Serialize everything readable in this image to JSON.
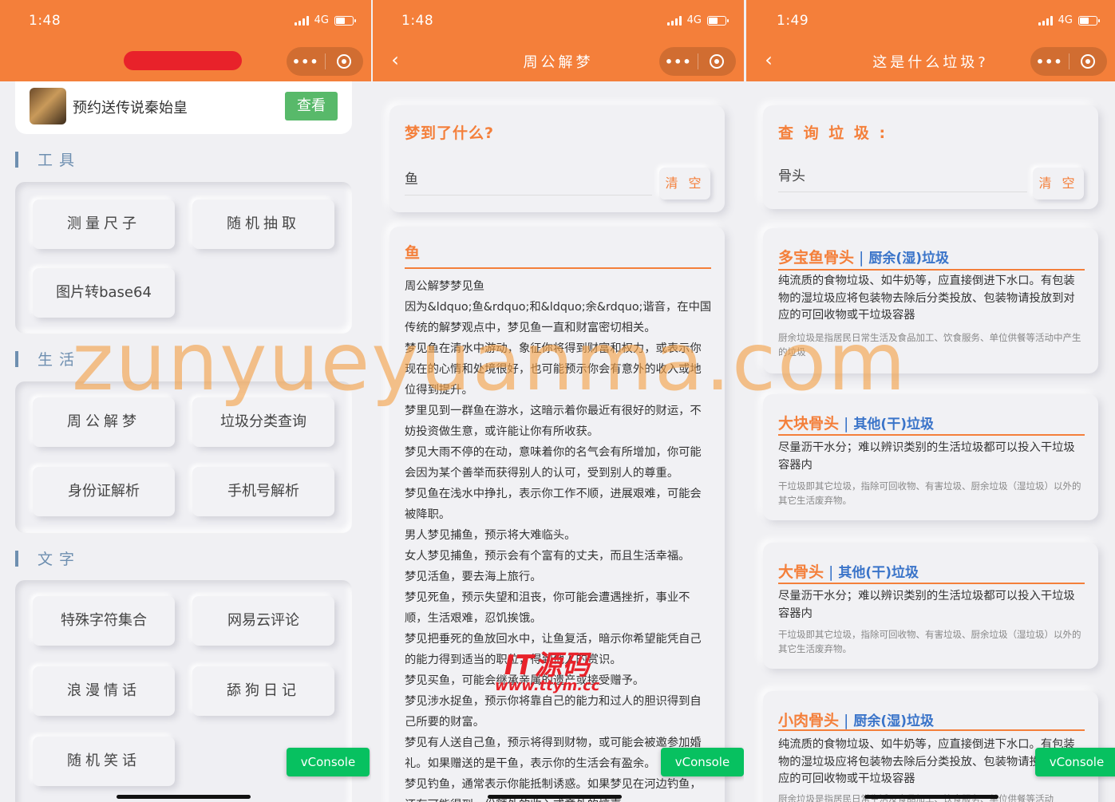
{
  "screens": [
    {
      "time": "1:48",
      "network": "4G",
      "banner": {
        "text": "预约送传说秦始皇",
        "button": "查看"
      },
      "sections": [
        {
          "title": "工具",
          "items": [
            "测量尺子",
            "随机抽取",
            "图片转base64"
          ]
        },
        {
          "title": "生活",
          "items": [
            "周公解梦",
            "垃圾分类查询",
            "身份证解析",
            "手机号解析"
          ]
        },
        {
          "title": "文字",
          "items": [
            "特殊字符集合",
            "网易云评论",
            "浪漫情话",
            "舔狗日记",
            "随机笑话"
          ]
        }
      ],
      "vconsole": "vConsole"
    },
    {
      "time": "1:48",
      "network": "4G",
      "title": "周公解梦",
      "query_label": "梦到了什么?",
      "query_value": "鱼",
      "clear": "清 空",
      "result_title": "鱼",
      "result_lines": [
        "周公解梦梦见鱼",
        "因为&ldquo;鱼&rdquo;和&ldquo;余&rdquo;谐音，在中国",
        "传统的解梦观点中，梦见鱼一直和财富密切相关。",
        "梦见鱼在清水中游动，象征你将得到财富和权力，或表示你",
        "现在的心情和处境很好，也可能预示你会有意外的收入或地",
        "位得到提升。",
        "梦里见到一群鱼在游水，这暗示着你最近有很好的财运，不",
        "妨投资做生意，或许能让你有所收获。",
        "梦见大雨不停的在动，意味着你的名气会有所增加，你可能",
        "会因为某个善举而获得别人的认可，受到别人的尊重。",
        "梦见鱼在浅水中挣扎，表示你工作不顺，进展艰难，可能会",
        "被降职。",
        "男人梦见捕鱼，预示将大难临头。",
        "女人梦见捕鱼，预示会有个富有的丈夫，而且生活幸福。",
        "梦见活鱼，要去海上旅行。",
        "梦见死鱼，预示失望和沮丧，你可能会遭遇挫折，事业不",
        "顺，生活艰难，忍饥挨饿。",
        "梦见把垂死的鱼放回水中，让鱼复活，暗示你希望能凭自己",
        "的能力得到适当的职位，得到他人的赏识。",
        "梦见买鱼，可能会继承亲属的遗产或接受赠予。",
        "梦见涉水捉鱼，预示你将靠自己的能力和过人的胆识得到自",
        "己所要的财富。",
        "梦见有人送自己鱼，预示将得到财物，或可能会被邀参加婚",
        "礼。如果赠送的是干鱼，表示你的生活会有盈余。",
        "梦见钓鱼，通常表示你能抵制诱惑。如果梦见在河边钓鱼，",
        "还有可能得到一份额外的收入或意外的惊喜。"
      ],
      "vconsole": "vConsole"
    },
    {
      "time": "1:49",
      "network": "4G",
      "title": "这是什么垃圾?",
      "query_label": "查 询 垃 圾 :",
      "query_value": "骨头",
      "clear": "清 空",
      "results": [
        {
          "name": "多宝鱼骨头",
          "category": "厨余(湿)垃圾",
          "desc": "纯流质的食物垃圾、如牛奶等，应直接倒进下水口。有包装物的湿垃圾应将包装物去除后分类投放、包装物请投放到对应的可回收物或干垃圾容器",
          "note": "厨余垃圾是指居民日常生活及食品加工、饮食服务、单位供餐等活动中产生的垃圾"
        },
        {
          "name": "大块骨头",
          "category": "其他(干)垃圾",
          "desc": "尽量沥干水分；难以辨识类别的生活垃圾都可以投入干垃圾容器内",
          "note": "干垃圾即其它垃圾，指除可回收物、有害垃圾、厨余垃圾（湿垃圾）以外的其它生活废弃物。"
        },
        {
          "name": "大骨头",
          "category": "其他(干)垃圾",
          "desc": "尽量沥干水分；难以辨识类别的生活垃圾都可以投入干垃圾容器内",
          "note": "干垃圾即其它垃圾，指除可回收物、有害垃圾、厨余垃圾（湿垃圾）以外的其它生活废弃物。"
        },
        {
          "name": "小肉骨头",
          "category": "厨余(湿)垃圾",
          "desc": "纯流质的食物垃圾、如牛奶等，应直接倒进下水口。有包装物的湿垃圾应将包装物去除后分类投放、包装物请投放到对应的可回收物或干垃圾容器",
          "note": "厨余垃圾是指居民日常生活及食品加工、饮食服务、单位供餐等活动"
        }
      ],
      "vconsole": "vConsole"
    }
  ],
  "watermark": "zunyueyuanma.com",
  "watermark2": {
    "line1": "IT源码",
    "line2": "www.ttym.cc"
  },
  "colors": {
    "accent": "#f47f3a",
    "link": "#3a74c9",
    "vconsole": "#07c160",
    "banner_btn": "#58b96a"
  }
}
